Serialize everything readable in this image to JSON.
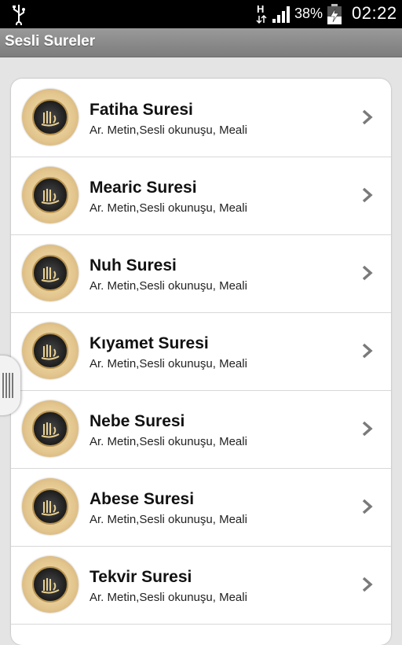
{
  "status_bar": {
    "battery_percent": "38%",
    "time": "02:22",
    "icons": [
      "usb-icon",
      "hspa-icon",
      "signal-icon",
      "battery-charging-icon"
    ]
  },
  "app_bar": {
    "title": "Sesli Sureler"
  },
  "list": {
    "items": [
      {
        "title": "Fatiha Suresi",
        "subtitle": "Ar. Metin,Sesli okunuşu, Meali"
      },
      {
        "title": "Mearic Suresi",
        "subtitle": "Ar. Metin,Sesli okunuşu, Meali"
      },
      {
        "title": "Nuh Suresi",
        "subtitle": "Ar. Metin,Sesli okunuşu, Meali"
      },
      {
        "title": "Kıyamet Suresi",
        "subtitle": "Ar. Metin,Sesli okunuşu, Meali"
      },
      {
        "title": "Nebe Suresi",
        "subtitle": "Ar. Metin,Sesli okunuşu, Meali"
      },
      {
        "title": "Abese Suresi",
        "subtitle": "Ar. Metin,Sesli okunuşu, Meali"
      },
      {
        "title": "Tekvir Suresi",
        "subtitle": "Ar. Metin,Sesli okunuşu, Meali"
      }
    ]
  },
  "colors": {
    "app_bar": "#8a8a8a",
    "background": "#e4e4e4",
    "card": "#ffffff",
    "chevron": "#7a7a7a"
  }
}
